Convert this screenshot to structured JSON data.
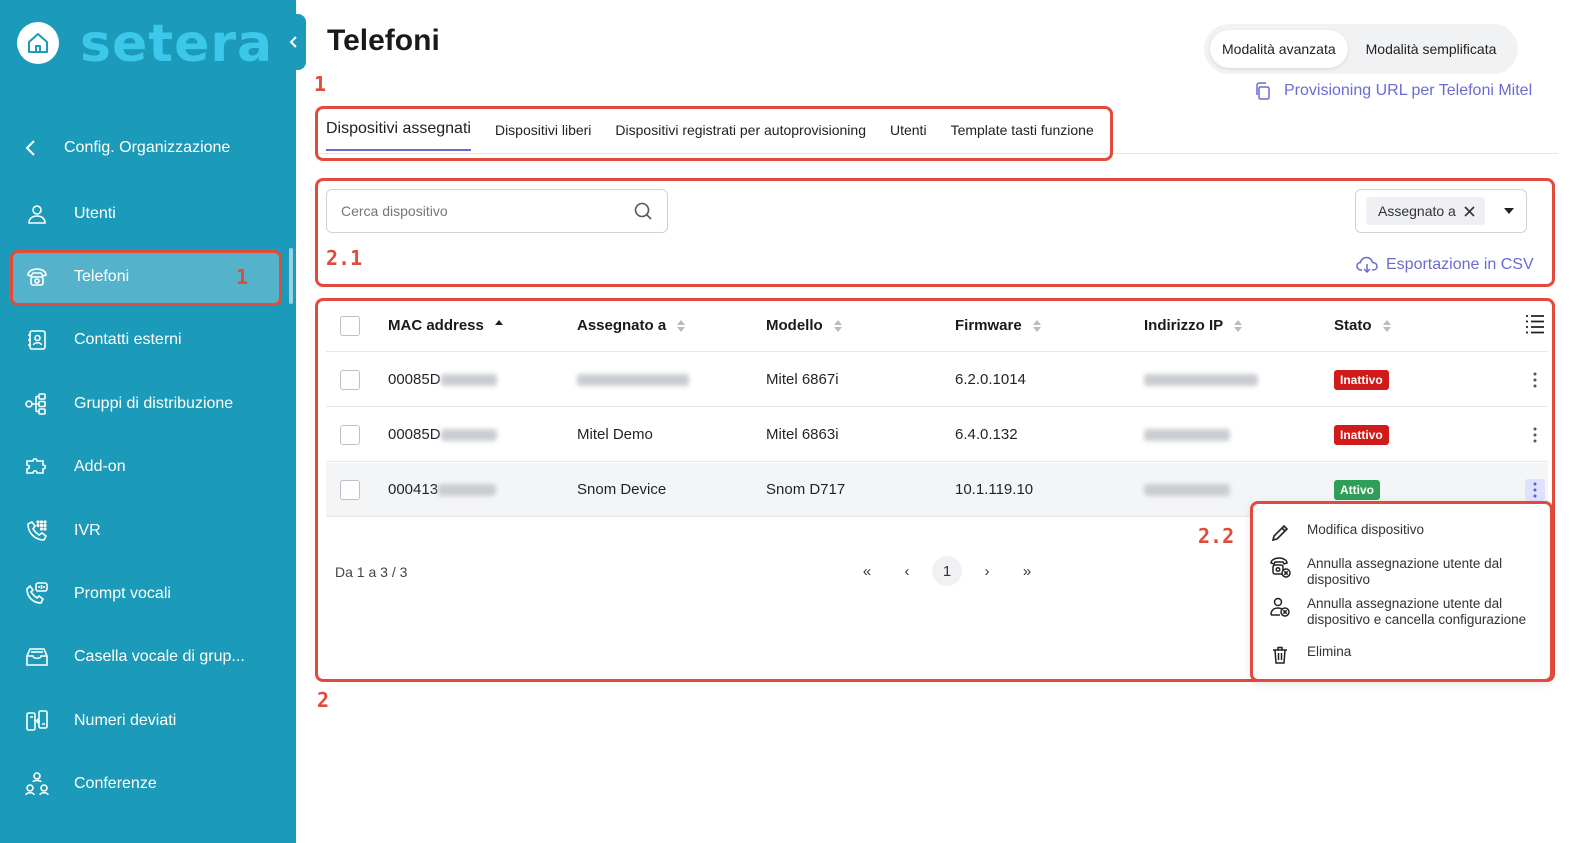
{
  "sidebar": {
    "logo_text": "setera",
    "back_label": "Config. Organizzazione",
    "items": [
      {
        "label": "Utenti",
        "icon": "user-icon"
      },
      {
        "label": "Telefoni",
        "icon": "phone-icon",
        "active": true,
        "annotation": "1"
      },
      {
        "label": "Contatti esterni",
        "icon": "contact-book-icon"
      },
      {
        "label": "Gruppi di distribuzione",
        "icon": "hierarchy-icon"
      },
      {
        "label": "Add-on",
        "icon": "puzzle-icon"
      },
      {
        "label": "IVR",
        "icon": "ivr-keypad-icon"
      },
      {
        "label": "Prompt vocali",
        "icon": "voice-prompt-icon"
      },
      {
        "label": "Casella vocale di grup...",
        "icon": "voicemail-inbox-icon"
      },
      {
        "label": "Numeri deviati",
        "icon": "forward-device-icon"
      },
      {
        "label": "Conferenze",
        "icon": "conference-icon"
      }
    ]
  },
  "header": {
    "title": "Telefoni",
    "mode_advanced": "Modalità avanzata",
    "mode_simple": "Modalità semplificata",
    "provisioning_link": "Provisioning URL per Telefoni Mitel"
  },
  "annotations": {
    "tabs": "1",
    "filters": "2.1",
    "table": "2",
    "menu": "2.2"
  },
  "tabs": [
    {
      "label": "Dispositivi assegnati",
      "active": true
    },
    {
      "label": "Dispositivi liberi"
    },
    {
      "label": "Dispositivi registrati per autoprovisioning"
    },
    {
      "label": "Utenti"
    },
    {
      "label": "Template tasti funzione"
    }
  ],
  "filters": {
    "search_placeholder": "Cerca dispositivo",
    "chip_label": "Assegnato a",
    "csv_export": "Esportazione in CSV"
  },
  "table": {
    "columns": [
      "MAC address",
      "Assegnato a",
      "Modello",
      "Firmware",
      "Indirizzo IP",
      "Stato"
    ],
    "rows": [
      {
        "mac_prefix": "00085D",
        "assigned": "",
        "model": "Mitel 6867i",
        "firmware": "6.2.0.1014",
        "status": "Inattivo",
        "status_kind": "off"
      },
      {
        "mac_prefix": "00085D",
        "assigned": "Mitel Demo",
        "model": "Mitel 6863i",
        "firmware": "6.4.0.132",
        "status": "Inattivo",
        "status_kind": "off"
      },
      {
        "mac_prefix": "000413",
        "assigned": "Snom Device",
        "model": "Snom D717",
        "firmware": "10.1.119.10",
        "status": "Attivo",
        "status_kind": "on"
      }
    ]
  },
  "pagination": {
    "range": "Da 1 a 3 / 3",
    "first": "«",
    "prev": "‹",
    "current": "1",
    "next": "›",
    "last": "»"
  },
  "context_menu": {
    "items": [
      {
        "label": "Modifica dispositivo",
        "icon": "pencil-icon"
      },
      {
        "label": "Annulla assegnazione utente dal dispositivo",
        "icon": "unassign-phone-icon"
      },
      {
        "label": "Annulla assegnazione utente dal dispositivo e cancella configurazione",
        "icon": "unassign-user-icon"
      },
      {
        "label": "Elimina",
        "icon": "trash-icon"
      }
    ]
  },
  "colors": {
    "sidebar_bg": "#1b9ab9",
    "accent": "#6a6bd1",
    "annotation": "#e24b3b",
    "status_inactive": "#d11a1a",
    "status_active": "#2f9e57"
  }
}
